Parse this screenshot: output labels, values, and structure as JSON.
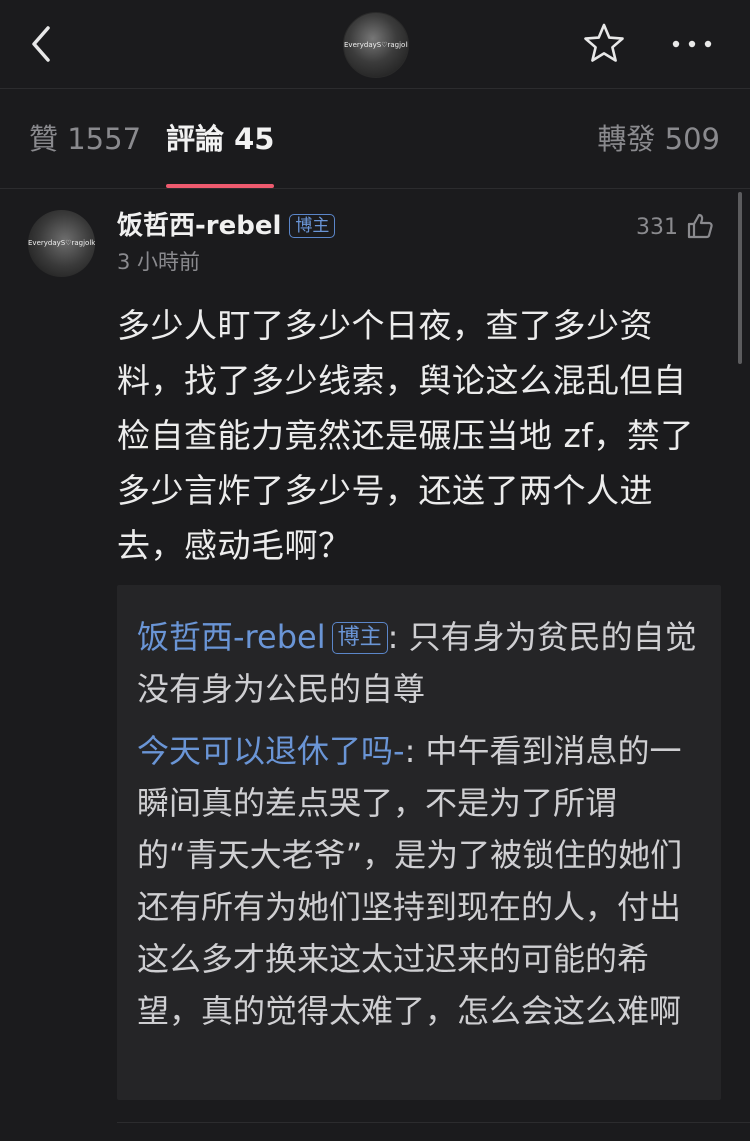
{
  "header": {
    "avatar_watermark": "EverydayS♡ragjolk"
  },
  "tabs": {
    "likes": "贊 1557",
    "comments": "評論 45",
    "reposts": "轉發 509"
  },
  "comment": {
    "avatar_watermark": "EverydayS♡ragjolk",
    "author": "饭哲西-rebel",
    "badge": "博主",
    "time": "3 小時前",
    "likes": "331",
    "text": "多少人盯了多少个日夜，查了多少资料，找了多少线索，舆论这么混乱但自检自查能力竟然还是碾压当地 zf，禁了多少言炸了多少号，还送了两个人进去，感动毛啊？",
    "replies": [
      {
        "author": "饭哲西-rebel",
        "badge": "博主",
        "text": ": 只有身为贫民的自觉没有身为公民的自尊"
      },
      {
        "author": "今天可以退休了吗-",
        "text": ": 中午看到消息的一瞬间真的差点哭了，不是为了所谓的“青天大老爷”，是为了被锁住的她们还有所有为她们坚持到现在的人，付出这么多才换来这太过迟来的可能的希望，真的觉得太难了，怎么会这么难啊"
      }
    ]
  },
  "colors": {
    "background": "#1b1b1d",
    "accent_indicator": "#ee5a6e",
    "link_blue": "#6a95d6",
    "muted": "#8a8a8e"
  }
}
